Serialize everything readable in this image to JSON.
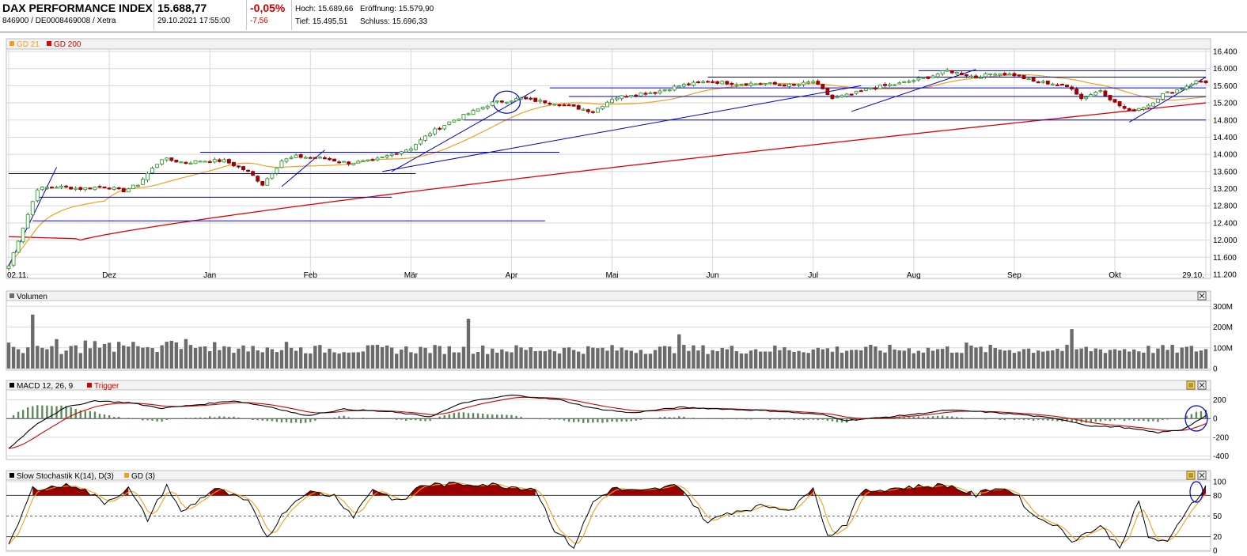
{
  "header": {
    "title": "DAX PERFORMANCE INDEX",
    "isin": "846900 / DE0008469008 / Xetra",
    "price": "15.688,77",
    "datetime": "29.10.2021 17:55:00",
    "change_pct": "-0,05%",
    "change_abs": "-7,56",
    "high": "Hoch: 15.689,66",
    "open": "Eröffnung: 15.579,90",
    "low": "Tief: 15.495,51",
    "close": "Schluss: 15.696,33"
  },
  "colors": {
    "up": "#2ea02e",
    "down": "#a00000",
    "ma21": "#f0a020",
    "ma200": "#e00000",
    "trend": "#0000cc",
    "volume": "#6b6b6b",
    "macd": "#000000",
    "trigger": "#d00000",
    "stochK": "#000000",
    "stochD": "#f0a020",
    "stochFill": "#9a0000",
    "grid": "#d8d8d8",
    "panelHead": "#f2f2f2"
  },
  "legends": {
    "price": [
      {
        "label": "GD 21",
        "color": "#f0a020"
      },
      {
        "label": "GD 200",
        "color": "#e00000"
      }
    ],
    "volume": "Volumen",
    "macd": {
      "label": "MACD 12, 26, 9",
      "trigger": "Trigger"
    },
    "stoch": {
      "label": "Slow Stochastik K(14), D(3)",
      "gd": "GD (3)"
    }
  },
  "chart_data": [
    {
      "type": "candlestick",
      "title": "DAX PERFORMANCE INDEX",
      "ylim": [
        11200,
        16400
      ],
      "y_ticks": [
        "16.400",
        "16.000",
        "15.600",
        "15.200",
        "14.800",
        "14.400",
        "14.000",
        "13.600",
        "13.200",
        "12.800",
        "12.400",
        "12.000",
        "11.600",
        "11.200"
      ],
      "x_ticks": [
        "02.11.",
        "Dez",
        "Jan",
        "Feb",
        "Mär",
        "Apr",
        "Mai",
        "Jun",
        "Jul",
        "Aug",
        "Sep",
        "Okt",
        "29.10."
      ],
      "anchors": [
        [
          0,
          11400
        ],
        [
          3,
          12300
        ],
        [
          6,
          13200
        ],
        [
          10,
          13250
        ],
        [
          15,
          13200
        ],
        [
          20,
          13250
        ],
        [
          24,
          13150
        ],
        [
          27,
          13300
        ],
        [
          29,
          13550
        ],
        [
          32,
          13900
        ],
        [
          37,
          13800
        ],
        [
          40,
          13850
        ],
        [
          45,
          13850
        ],
        [
          50,
          13600
        ],
        [
          53,
          13300
        ],
        [
          57,
          13850
        ],
        [
          60,
          13950
        ],
        [
          66,
          13900
        ],
        [
          71,
          13800
        ],
        [
          76,
          13850
        ],
        [
          80,
          14000
        ],
        [
          84,
          14150
        ],
        [
          88,
          14500
        ],
        [
          92,
          14750
        ],
        [
          96,
          14950
        ],
        [
          101,
          15200
        ],
        [
          107,
          15300
        ],
        [
          110,
          15250
        ],
        [
          114,
          15200
        ],
        [
          118,
          15100
        ],
        [
          122,
          15000
        ],
        [
          126,
          15300
        ],
        [
          130,
          15400
        ],
        [
          135,
          15450
        ],
        [
          140,
          15600
        ],
        [
          146,
          15700
        ],
        [
          152,
          15650
        ],
        [
          158,
          15650
        ],
        [
          164,
          15600
        ],
        [
          168,
          15700
        ],
        [
          172,
          15300
        ],
        [
          176,
          15400
        ],
        [
          180,
          15550
        ],
        [
          186,
          15650
        ],
        [
          192,
          15800
        ],
        [
          196,
          15950
        ],
        [
          202,
          15800
        ],
        [
          206,
          15900
        ],
        [
          210,
          15850
        ],
        [
          214,
          15700
        ],
        [
          218,
          15650
        ],
        [
          222,
          15550
        ],
        [
          224,
          15300
        ],
        [
          228,
          15500
        ],
        [
          231,
          15200
        ],
        [
          234,
          15000
        ],
        [
          238,
          15150
        ],
        [
          241,
          15400
        ],
        [
          244,
          15500
        ],
        [
          248,
          15700
        ],
        [
          250,
          15690
        ]
      ],
      "ma200_range": [
        12050,
        15200
      ],
      "trend_h": [
        [
          0,
          85,
          13550
        ],
        [
          6,
          80,
          13000
        ],
        [
          5,
          112,
          12450
        ],
        [
          40,
          80,
          14050
        ],
        [
          80,
          115,
          14050
        ],
        [
          113,
          250,
          15550
        ],
        [
          117,
          250,
          15350
        ],
        [
          95,
          250,
          14800
        ],
        [
          146,
          250,
          15800
        ],
        [
          190,
          250,
          15950
        ]
      ],
      "trend_d": [
        [
          0,
          11400,
          10,
          13700
        ],
        [
          57,
          13250,
          66,
          14100
        ],
        [
          80,
          13600,
          110,
          15500
        ],
        [
          78,
          13600,
          178,
          15600
        ],
        [
          176,
          15000,
          202,
          15980
        ],
        [
          234,
          14750,
          250,
          15800
        ]
      ],
      "circle_idx": 104
    },
    {
      "type": "bar",
      "title": "Volumen",
      "y_ticks": [
        "300M",
        "200M",
        "100M",
        "0"
      ],
      "ylim": [
        0,
        320
      ],
      "spikes": [
        [
          5,
          260
        ],
        [
          96,
          240
        ],
        [
          140,
          165
        ],
        [
          179,
          105
        ],
        [
          200,
          125
        ],
        [
          222,
          190
        ]
      ]
    },
    {
      "type": "line",
      "title": "MACD 12, 26, 9",
      "y_ticks": [
        "200",
        "0",
        "-200",
        "-400"
      ],
      "ylim": [
        -420,
        280
      ],
      "series": [
        {
          "name": "MACD 12, 26, 9"
        },
        {
          "name": "Trigger"
        }
      ],
      "anchors": [
        [
          0,
          -320
        ],
        [
          6,
          -50
        ],
        [
          12,
          120
        ],
        [
          18,
          190
        ],
        [
          25,
          170
        ],
        [
          32,
          110
        ],
        [
          40,
          150
        ],
        [
          47,
          190
        ],
        [
          55,
          120
        ],
        [
          62,
          30
        ],
        [
          70,
          100
        ],
        [
          80,
          70
        ],
        [
          88,
          20
        ],
        [
          95,
          170
        ],
        [
          105,
          250
        ],
        [
          115,
          200
        ],
        [
          122,
          110
        ],
        [
          130,
          60
        ],
        [
          140,
          120
        ],
        [
          150,
          100
        ],
        [
          160,
          80
        ],
        [
          170,
          40
        ],
        [
          175,
          -20
        ],
        [
          182,
          10
        ],
        [
          190,
          50
        ],
        [
          196,
          90
        ],
        [
          204,
          70
        ],
        [
          212,
          40
        ],
        [
          220,
          -10
        ],
        [
          226,
          -80
        ],
        [
          232,
          -90
        ],
        [
          240,
          -150
        ],
        [
          245,
          -120
        ],
        [
          250,
          30
        ]
      ]
    },
    {
      "type": "line",
      "title": "Slow Stochastik K(14), D(3)",
      "y_ticks": [
        "100",
        "80",
        "50",
        "20",
        "0"
      ],
      "ylim": [
        0,
        100
      ],
      "series": [
        {
          "name": "Slow Stochastik K(14), D(3)"
        },
        {
          "name": "GD (3)"
        }
      ],
      "anchors": [
        [
          0,
          5
        ],
        [
          5,
          90
        ],
        [
          14,
          95
        ],
        [
          20,
          70
        ],
        [
          25,
          90
        ],
        [
          29,
          45
        ],
        [
          33,
          95
        ],
        [
          36,
          55
        ],
        [
          43,
          90
        ],
        [
          50,
          70
        ],
        [
          54,
          20
        ],
        [
          58,
          60
        ],
        [
          62,
          85
        ],
        [
          68,
          80
        ],
        [
          72,
          50
        ],
        [
          76,
          90
        ],
        [
          82,
          70
        ],
        [
          86,
          95
        ],
        [
          98,
          97
        ],
        [
          110,
          90
        ],
        [
          114,
          30
        ],
        [
          118,
          5
        ],
        [
          122,
          70
        ],
        [
          126,
          90
        ],
        [
          132,
          85
        ],
        [
          140,
          95
        ],
        [
          146,
          40
        ],
        [
          150,
          55
        ],
        [
          158,
          65
        ],
        [
          164,
          60
        ],
        [
          168,
          95
        ],
        [
          171,
          20
        ],
        [
          175,
          40
        ],
        [
          178,
          85
        ],
        [
          184,
          90
        ],
        [
          188,
          92
        ],
        [
          196,
          95
        ],
        [
          202,
          80
        ],
        [
          206,
          92
        ],
        [
          210,
          85
        ],
        [
          214,
          50
        ],
        [
          218,
          40
        ],
        [
          222,
          15
        ],
        [
          228,
          35
        ],
        [
          232,
          5
        ],
        [
          236,
          70
        ],
        [
          238,
          20
        ],
        [
          242,
          10
        ],
        [
          246,
          60
        ],
        [
          250,
          92
        ]
      ]
    }
  ]
}
